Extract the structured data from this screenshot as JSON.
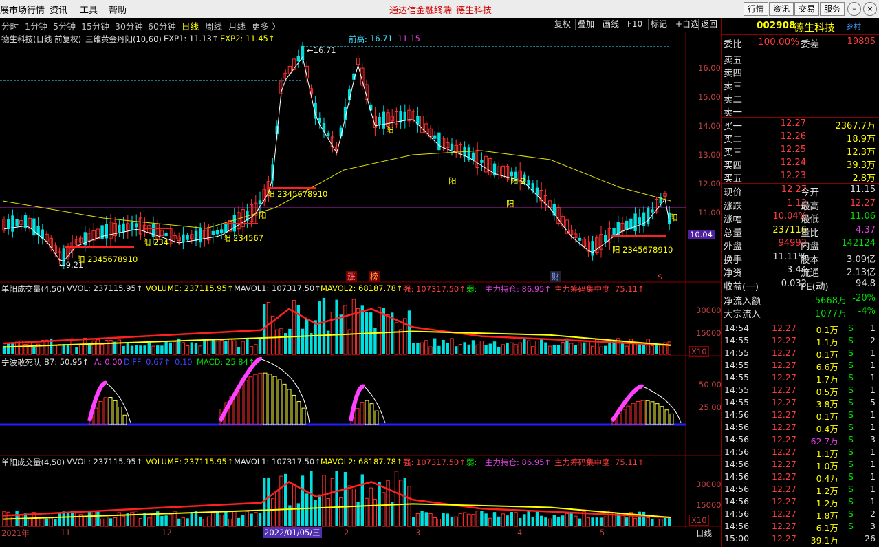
{
  "menubar": {
    "items": [
      "展市场行情",
      "资讯",
      "工具",
      "帮助"
    ],
    "title_left": "通达信金融终端",
    "title_right": "德生科技",
    "buttons": [
      "行情",
      "资讯",
      "交易",
      "服务"
    ]
  },
  "periodbar": {
    "periods": [
      "分时",
      "1分钟",
      "5分钟",
      "15分钟",
      "30分钟",
      "60分钟",
      "日线",
      "周线",
      "月线",
      "更多 〉"
    ],
    "active": "日线",
    "tools": [
      "复权",
      "叠加",
      "画线",
      "F10",
      "标记",
      "+自选",
      "返回"
    ]
  },
  "main_header": {
    "name": "德生科技(日线 前复权)",
    "formula": "三维黄金丹阳(10,60)",
    "exp1": "EXP1: 11.13↑",
    "exp2": "EXP2: 11.45↑"
  },
  "price_chart": {
    "prev_high_label": "前高:",
    "prev_high_a": "16.71",
    "prev_high_b": "11.15",
    "peak_label": "←16.71",
    "low_label": "←9.21",
    "current_price_tag": "10.04",
    "y_ticks": [
      "16.00",
      "15.00",
      "14.00",
      "13.00",
      "12.00",
      "11.00"
    ],
    "labels": [
      "阳 2345678910",
      "阳",
      "阳 234",
      "阳 234567",
      "阳 2345678910",
      "阳",
      "阳",
      "阳",
      "阳 2",
      "阳",
      "阳 2345678910"
    ],
    "event_tags": [
      "涨",
      "榜",
      "财",
      "$"
    ]
  },
  "vol_panel": {
    "title": "单阳成交量(4,50)",
    "vvol": "VVOL: 237115.95↑",
    "volume": "VOLUME: 237115.95↑",
    "mavol1": "MAVOL1: 107317.50↑",
    "mavol2": "MAVOL2: 68187.78↑",
    "strong": "强: 107317.50↑",
    "weak": "弱:",
    "hold": "主力持仓: 86.95↑",
    "conc": "主力筹码集中度: 75.11↑",
    "y_ticks": [
      "30000",
      "15000"
    ],
    "unit": "X10"
  },
  "macd_panel": {
    "title": "宁波敢死队",
    "b7": "B7: 50.95↑",
    "a": "A: 0.00",
    "diff": "DIFF: 0.67↑",
    "dea": "0.10",
    "macd": "MACD: 25.84↑",
    "y_ticks": [
      "50.00",
      "25.00"
    ]
  },
  "vol_panel2": {
    "title": "单阳成交量(4,50)",
    "vvol": "VVOL: 237115.95↑",
    "volume": "VOLUME: 237115.95↑",
    "mavol1": "MAVOL1: 107317.50↑",
    "mavol2": "MAVOL2: 68187.78↑",
    "strong": "强: 107317.50↑",
    "weak": "弱:",
    "hold": "主力持仓: 86.95↑",
    "conc": "主力筹码集中度: 75.11↑",
    "y_ticks": [
      "30000",
      "15000"
    ],
    "unit": "X10"
  },
  "footer": {
    "year": "2021年",
    "months": [
      "11",
      "12",
      "2022/01/05/三",
      "2",
      "3",
      "4",
      "5"
    ],
    "period": "日线"
  },
  "quote": {
    "code": "002908",
    "name": "德生科技",
    "tag": "乡村",
    "weibi_label": "委比",
    "weibi": "100.00%",
    "weicha_label": "委差",
    "weicha": "19895",
    "sell": [
      {
        "label": "卖五",
        "price": "",
        "vol": ""
      },
      {
        "label": "卖四",
        "price": "",
        "vol": ""
      },
      {
        "label": "卖三",
        "price": "",
        "vol": ""
      },
      {
        "label": "卖二",
        "price": "",
        "vol": ""
      },
      {
        "label": "卖一",
        "price": "",
        "vol": ""
      }
    ],
    "buy": [
      {
        "label": "买一",
        "price": "12.27",
        "vol": "2367.7万"
      },
      {
        "label": "买二",
        "price": "12.26",
        "vol": "18.9万"
      },
      {
        "label": "买三",
        "price": "12.25",
        "vol": "12.3万"
      },
      {
        "label": "买四",
        "price": "12.24",
        "vol": "39.3万"
      },
      {
        "label": "买五",
        "price": "12.23",
        "vol": "2.8万"
      }
    ],
    "stats": [
      {
        "l1": "现价",
        "v1": "12.27",
        "c1": "red",
        "l2": "今开",
        "v2": "11.15",
        "c2": "white"
      },
      {
        "l1": "涨跌",
        "v1": "1.12",
        "c1": "red",
        "l2": "最高",
        "v2": "12.27",
        "c2": "red"
      },
      {
        "l1": "涨幅",
        "v1": "10.04%",
        "c1": "red",
        "l2": "最低",
        "v2": "11.06",
        "c2": "green"
      },
      {
        "l1": "总量",
        "v1": "237116",
        "c1": "yellow",
        "l2": "量比",
        "v2": "4.37",
        "c2": "magenta"
      },
      {
        "l1": "外盘",
        "v1": "94992",
        "c1": "red",
        "l2": "内盘",
        "v2": "142124",
        "c2": "green"
      },
      {
        "l1": "换手",
        "v1": "11.11%",
        "c1": "white",
        "l2": "股本",
        "v2": "3.09亿",
        "c2": "white"
      },
      {
        "l1": "净资",
        "v1": "3.44",
        "c1": "white",
        "l2": "流通",
        "v2": "2.13亿",
        "c2": "white"
      },
      {
        "l1": "收益(一)",
        "v1": "0.032",
        "c1": "white",
        "l2": "PE(动)",
        "v2": "94.8",
        "c2": "white"
      }
    ],
    "flow": [
      {
        "label": "净流入额",
        "value": "-5668万",
        "pct": "-20%"
      },
      {
        "label": "大宗流入",
        "value": "-1077万",
        "pct": "-4%"
      }
    ],
    "ticks": [
      [
        "14:54",
        "12.27",
        "0.1万",
        "S",
        "1"
      ],
      [
        "14:55",
        "12.27",
        "1.1万",
        "S",
        "2"
      ],
      [
        "14:55",
        "12.27",
        "0.1万",
        "S",
        "1"
      ],
      [
        "14:55",
        "12.27",
        "6.6万",
        "S",
        "1"
      ],
      [
        "14:55",
        "12.27",
        "1.7万",
        "S",
        "1"
      ],
      [
        "14:55",
        "12.27",
        "0.5万",
        "S",
        "1"
      ],
      [
        "14:55",
        "12.27",
        "3.8万",
        "S",
        "5"
      ],
      [
        "14:56",
        "12.27",
        "0.1万",
        "S",
        "1"
      ],
      [
        "14:56",
        "12.27",
        "0.4万",
        "S",
        "1"
      ],
      [
        "14:56",
        "12.27",
        "62.7万",
        "S",
        "3"
      ],
      [
        "14:56",
        "12.27",
        "1.1万",
        "S",
        "1"
      ],
      [
        "14:56",
        "12.27",
        "1.0万",
        "S",
        "1"
      ],
      [
        "14:56",
        "12.27",
        "0.4万",
        "S",
        "1"
      ],
      [
        "14:56",
        "12.27",
        "1.2万",
        "S",
        "1"
      ],
      [
        "14:56",
        "12.27",
        "1.2万",
        "S",
        "1"
      ],
      [
        "14:56",
        "12.27",
        "1.8万",
        "S",
        "2"
      ],
      [
        "14:56",
        "12.27",
        "6.1万",
        "S",
        "3"
      ],
      [
        "15:00",
        "12.27",
        "39.1万",
        "",
        "26"
      ]
    ]
  }
}
